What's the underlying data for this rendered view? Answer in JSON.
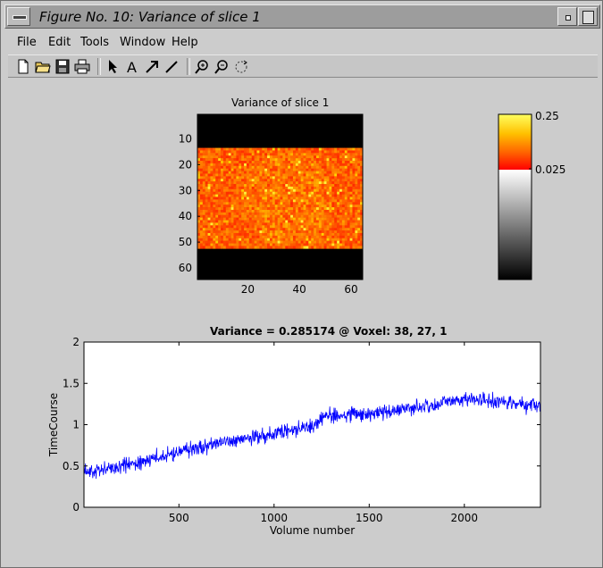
{
  "window": {
    "title": "Figure No. 10: Variance of slice 1"
  },
  "menu": [
    "File",
    "Edit",
    "Tools",
    "Window",
    "Help"
  ],
  "toolbar": [
    "new-file-icon",
    "open-folder-icon",
    "save-icon",
    "print-icon",
    "arrow-pointer-icon",
    "text-icon",
    "arrow-icon",
    "line-icon",
    "zoom-in-icon",
    "zoom-out-icon",
    "rotate-icon"
  ],
  "image_plot": {
    "title": "Variance of slice 1",
    "yticks": [
      "10",
      "20",
      "30",
      "40",
      "50",
      "60"
    ],
    "xticks": [
      "20",
      "40",
      "60"
    ],
    "colormap": "hot-over-gray",
    "brain_rows": [
      13,
      52
    ]
  },
  "colorbar": {
    "top_label": "0.25",
    "mid_label": "0.025"
  },
  "chart_data": {
    "type": "line",
    "title": "Variance = 0.285174 @ Voxel: 38, 27, 1",
    "xlabel": "Volume number",
    "ylabel": "TimeCourse",
    "xlim": [
      1,
      2400
    ],
    "ylim": [
      0,
      2
    ],
    "xticks": [
      500,
      1000,
      1500,
      2000
    ],
    "yticks": [
      0,
      0.5,
      1,
      1.5,
      2
    ],
    "color": "#0000ff",
    "series": [
      {
        "trend_x": [
          1,
          250,
          600,
          900,
          1200,
          1260,
          1500,
          1800,
          1950,
          2100,
          2400
        ],
        "trend_y": [
          0.42,
          0.52,
          0.72,
          0.85,
          0.97,
          1.1,
          1.13,
          1.22,
          1.3,
          1.3,
          1.22
        ],
        "noise_amplitude": 0.09
      }
    ]
  }
}
